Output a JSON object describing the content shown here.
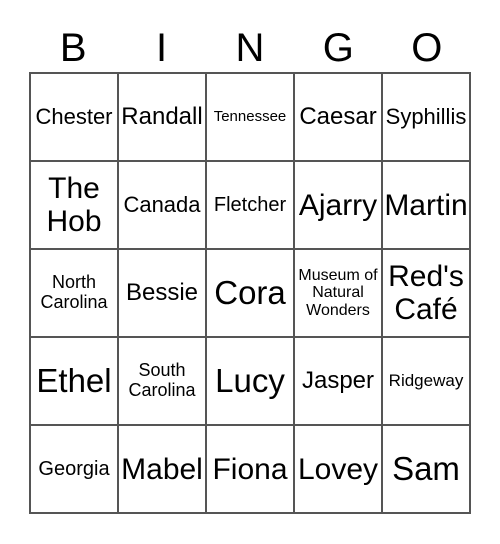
{
  "header": [
    "B",
    "I",
    "N",
    "G",
    "O"
  ],
  "cells": [
    [
      "Chester",
      "Randall",
      "Tennessee",
      "Caesar",
      "Syphillis"
    ],
    [
      "The Hob",
      "Canada",
      "Fletcher",
      "Ajarry",
      "Martin"
    ],
    [
      "North Carolina",
      "Bessie",
      "Cora",
      "Museum of Natural Wonders",
      "Red's Café"
    ],
    [
      "Ethel",
      "South Carolina",
      "Lucy",
      "Jasper",
      "Ridgeway"
    ],
    [
      "Georgia",
      "Mabel",
      "Fiona",
      "Lovey",
      "Sam"
    ]
  ]
}
